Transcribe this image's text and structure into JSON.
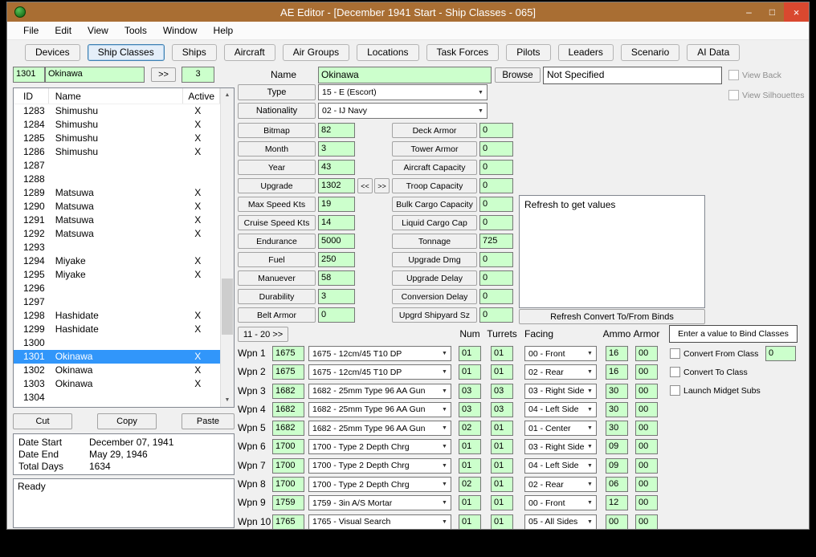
{
  "window": {
    "title": "AE Editor - [December 1941 Start - Ship Classes - 065]",
    "controls": {
      "minimize": "–",
      "maximize": "□",
      "close": "×"
    }
  },
  "menu": {
    "items": [
      {
        "label": "File"
      },
      {
        "label": "Edit"
      },
      {
        "label": "View"
      },
      {
        "label": "Tools"
      },
      {
        "label": "Window"
      },
      {
        "label": "Help"
      }
    ]
  },
  "tabs": [
    {
      "label": "Devices"
    },
    {
      "label": "Ship Classes",
      "selected": true
    },
    {
      "label": "Ships"
    },
    {
      "label": "Aircraft"
    },
    {
      "label": "Air Groups"
    },
    {
      "label": "Locations"
    },
    {
      "label": "Task Forces"
    },
    {
      "label": "Pilots"
    },
    {
      "label": "Leaders"
    },
    {
      "label": "Scenario"
    },
    {
      "label": "AI Data"
    }
  ],
  "browser": {
    "id_value": "1301",
    "name_value": "Okinawa",
    "next_button": ">>",
    "variant_value": "3",
    "columns": {
      "id": "ID",
      "name": "Name",
      "active": "Active"
    },
    "rows": [
      {
        "id": "1283",
        "name": "Shimushu",
        "x": "X"
      },
      {
        "id": "1284",
        "name": "Shimushu",
        "x": "X"
      },
      {
        "id": "1285",
        "name": "Shimushu",
        "x": "X"
      },
      {
        "id": "1286",
        "name": "Shimushu",
        "x": "X"
      },
      {
        "id": "1287",
        "name": "",
        "x": ""
      },
      {
        "id": "1288",
        "name": "",
        "x": ""
      },
      {
        "id": "1289",
        "name": "Matsuwa",
        "x": "X"
      },
      {
        "id": "1290",
        "name": "Matsuwa",
        "x": "X"
      },
      {
        "id": "1291",
        "name": "Matsuwa",
        "x": "X"
      },
      {
        "id": "1292",
        "name": "Matsuwa",
        "x": "X"
      },
      {
        "id": "1293",
        "name": "",
        "x": ""
      },
      {
        "id": "1294",
        "name": "Miyake",
        "x": "X"
      },
      {
        "id": "1295",
        "name": "Miyake",
        "x": "X"
      },
      {
        "id": "1296",
        "name": "",
        "x": ""
      },
      {
        "id": "1297",
        "name": "",
        "x": ""
      },
      {
        "id": "1298",
        "name": "Hashidate",
        "x": "X"
      },
      {
        "id": "1299",
        "name": "Hashidate",
        "x": "X"
      },
      {
        "id": "1300",
        "name": "",
        "x": ""
      },
      {
        "id": "1301",
        "name": "Okinawa",
        "x": "X",
        "selected": true
      },
      {
        "id": "1302",
        "name": "Okinawa",
        "x": "X"
      },
      {
        "id": "1303",
        "name": "Okinawa",
        "x": "X"
      },
      {
        "id": "1304",
        "name": "",
        "x": ""
      }
    ],
    "cut": "Cut",
    "copy": "Copy",
    "paste": "Paste",
    "dates": [
      {
        "label": "Date Start",
        "value": "December 07, 1941"
      },
      {
        "label": "Date End",
        "value": "May 29, 1946"
      },
      {
        "label": "Total Days",
        "value": "1634"
      }
    ],
    "status": "Ready"
  },
  "detail": {
    "name_label": "Name",
    "name_value": "Okinawa",
    "browse_button": "Browse",
    "image_value": "Not Specified",
    "view_back": "View Back",
    "view_silhouettes": "View Silhouettes",
    "type_label": "Type",
    "type_value": "15 - E (Escort)",
    "nationality_label": "Nationality",
    "nationality_value": "02 - IJ Navy",
    "left_fields": [
      {
        "label": "Bitmap",
        "value": "82"
      },
      {
        "label": "Month",
        "value": "3"
      },
      {
        "label": "Year",
        "value": "43"
      },
      {
        "label": "Upgrade",
        "value": "1302",
        "nav": true,
        "nav_prev": "<<",
        "nav_next": ">>"
      },
      {
        "label": "Max Speed Kts",
        "value": "19"
      },
      {
        "label": "Cruise Speed Kts",
        "value": "14"
      },
      {
        "label": "Endurance",
        "value": "5000"
      },
      {
        "label": "Fuel",
        "value": "250"
      },
      {
        "label": "Manuever",
        "value": "58"
      },
      {
        "label": "Durability",
        "value": "3"
      },
      {
        "label": "Belt Armor",
        "value": "0"
      }
    ],
    "right_fields": [
      {
        "label": "Deck Armor",
        "value": "0"
      },
      {
        "label": "Tower Armor",
        "value": "0"
      },
      {
        "label": "Aircraft Capacity",
        "value": "0"
      },
      {
        "label": "Troop Capacity",
        "value": "0"
      },
      {
        "label": "Bulk Cargo Capacity",
        "value": "0"
      },
      {
        "label": "Liquid Cargo Cap",
        "value": "0"
      },
      {
        "label": "Tonnage",
        "value": "725"
      },
      {
        "label": "Upgrade Dmg",
        "value": "0"
      },
      {
        "label": "Upgrade Delay",
        "value": "0"
      },
      {
        "label": "Conversion Delay",
        "value": "0"
      },
      {
        "label": "Upgrd Shipyard Sz",
        "value": "0"
      }
    ],
    "refresh_note": "Refresh to get values",
    "refresh_binds_button": "Refresh Convert To/From Binds"
  },
  "weapons": {
    "page_button": "11 - 20 >>",
    "headers": {
      "num": "Num",
      "turrets": "Turrets",
      "facing": "Facing",
      "ammo": "Ammo",
      "armor": "Armor"
    },
    "bind_prompt": "Enter a value to Bind Classes",
    "bind_value": "0",
    "convert_from_label": "Convert From Class",
    "convert_to_label": "Convert To Class",
    "launch_midget_label": "Launch Midget Subs",
    "rows": [
      {
        "label": "Wpn 1",
        "id": "1675",
        "weapon": "1675 - 12cm/45 T10 DP",
        "num": "01",
        "turrets": "01",
        "facing": "00 - Front",
        "ammo": "16",
        "armor": "00"
      },
      {
        "label": "Wpn 2",
        "id": "1675",
        "weapon": "1675 - 12cm/45 T10 DP",
        "num": "01",
        "turrets": "01",
        "facing": "02 - Rear",
        "ammo": "16",
        "armor": "00"
      },
      {
        "label": "Wpn 3",
        "id": "1682",
        "weapon": "1682 - 25mm Type 96 AA Gun",
        "num": "03",
        "turrets": "03",
        "facing": "03 - Right Side",
        "ammo": "30",
        "armor": "00"
      },
      {
        "label": "Wpn 4",
        "id": "1682",
        "weapon": "1682 - 25mm Type 96 AA Gun",
        "num": "03",
        "turrets": "03",
        "facing": "04 - Left Side",
        "ammo": "30",
        "armor": "00"
      },
      {
        "label": "Wpn 5",
        "id": "1682",
        "weapon": "1682 - 25mm Type 96 AA Gun",
        "num": "02",
        "turrets": "01",
        "facing": "01 - Center",
        "ammo": "30",
        "armor": "00"
      },
      {
        "label": "Wpn 6",
        "id": "1700",
        "weapon": "1700 - Type 2 Depth Chrg",
        "num": "01",
        "turrets": "01",
        "facing": "03 - Right Side",
        "ammo": "09",
        "armor": "00"
      },
      {
        "label": "Wpn 7",
        "id": "1700",
        "weapon": "1700 - Type 2 Depth Chrg",
        "num": "01",
        "turrets": "01",
        "facing": "04 - Left Side",
        "ammo": "09",
        "armor": "00"
      },
      {
        "label": "Wpn 8",
        "id": "1700",
        "weapon": "1700 - Type 2 Depth Chrg",
        "num": "02",
        "turrets": "01",
        "facing": "02 - Rear",
        "ammo": "06",
        "armor": "00"
      },
      {
        "label": "Wpn 9",
        "id": "1759",
        "weapon": "1759 - 3in A/S Mortar",
        "num": "01",
        "turrets": "01",
        "facing": "00 - Front",
        "ammo": "12",
        "armor": "00"
      },
      {
        "label": "Wpn 10",
        "id": "1765",
        "weapon": "1765 - Visual Search",
        "num": "01",
        "turrets": "01",
        "facing": "05 - All Sides",
        "ammo": "00",
        "armor": "00"
      }
    ]
  },
  "colors": {
    "titlebar": "#a96e33",
    "close_button": "#d9482f",
    "field_green": "#ccffcc",
    "selection_blue": "#3196fa"
  }
}
